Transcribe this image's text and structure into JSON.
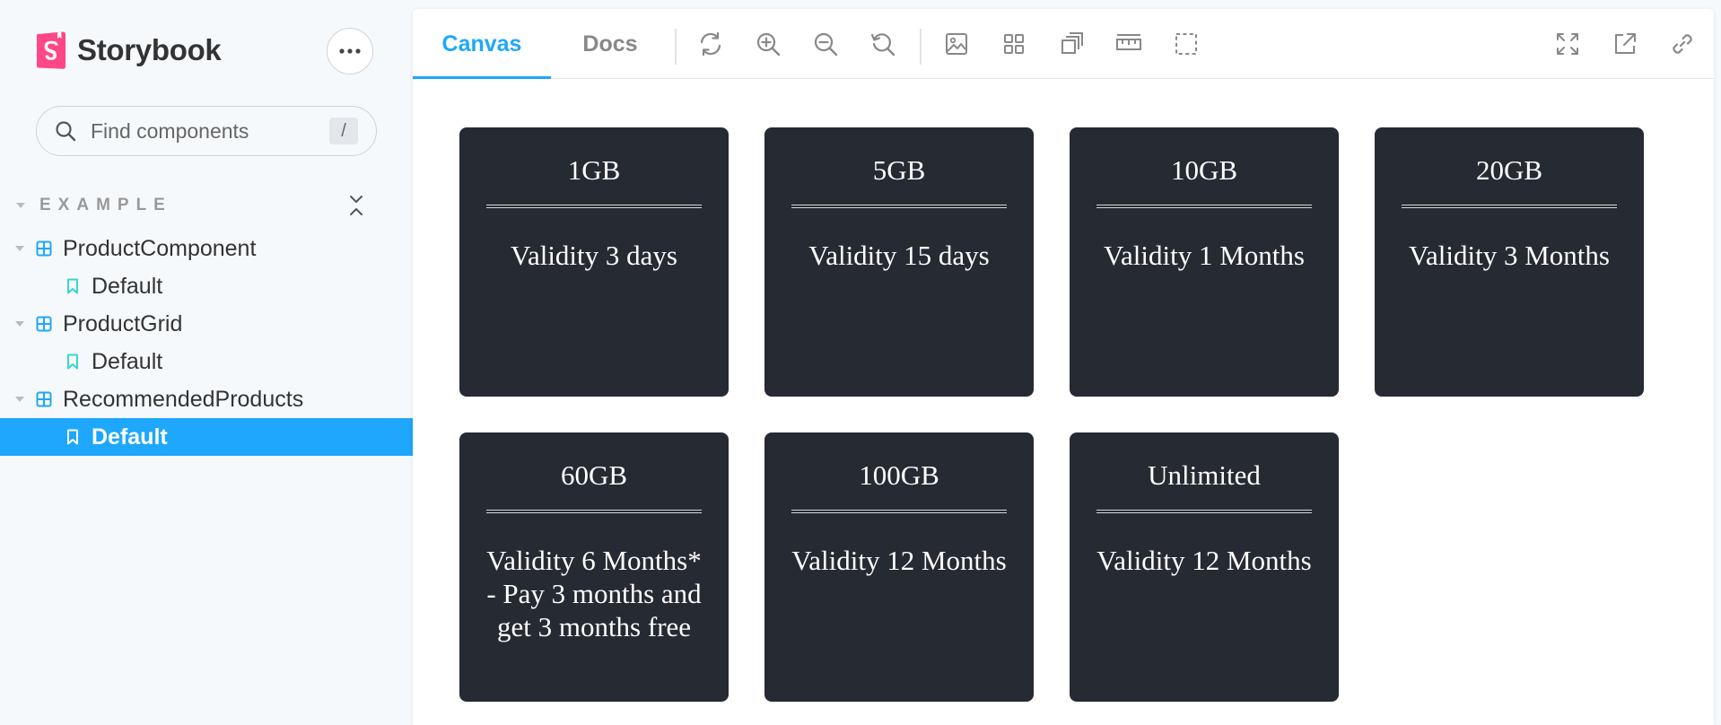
{
  "sidebar": {
    "brand": "Storybook",
    "search": {
      "placeholder": "Find components",
      "shortcut": "/"
    },
    "group": "EXAMPLE",
    "tree": [
      {
        "type": "component",
        "label": "ProductComponent"
      },
      {
        "type": "story",
        "label": "Default",
        "selected": false
      },
      {
        "type": "component",
        "label": "ProductGrid"
      },
      {
        "type": "story",
        "label": "Default",
        "selected": false
      },
      {
        "type": "component",
        "label": "RecommendedProducts"
      },
      {
        "type": "story",
        "label": "Default",
        "selected": true
      }
    ]
  },
  "toolbar": {
    "tabs": [
      {
        "label": "Canvas",
        "active": true
      },
      {
        "label": "Docs",
        "active": false
      }
    ],
    "tools": [
      "sync-icon",
      "zoom-in-icon",
      "zoom-out-icon",
      "zoom-reset-icon",
      "background-icon",
      "grid-icon",
      "outline-icon",
      "measure-icon",
      "viewport-icon"
    ],
    "right_tools": [
      "fullscreen-icon",
      "open-new-tab-icon",
      "copy-link-icon"
    ]
  },
  "cards": [
    {
      "title": "1GB",
      "desc": "Validity 3 days"
    },
    {
      "title": "5GB",
      "desc": "Validity 15 days"
    },
    {
      "title": "10GB",
      "desc": "Validity 1 Months"
    },
    {
      "title": "20GB",
      "desc": "Validity 3 Months"
    },
    {
      "title": "60GB",
      "desc": "Validity 6 Months* - Pay 3 months and get 3 months free"
    },
    {
      "title": "100GB",
      "desc": "Validity 12 Months"
    },
    {
      "title": "Unlimited",
      "desc": "Validity 12 Months"
    }
  ],
  "colors": {
    "accent": "#1ea7fd",
    "brand_pink": "#ff4785",
    "story_teal": "#37d5d3",
    "card_bg": "#262a33",
    "sidebar_bg": "#f6f9fc"
  }
}
